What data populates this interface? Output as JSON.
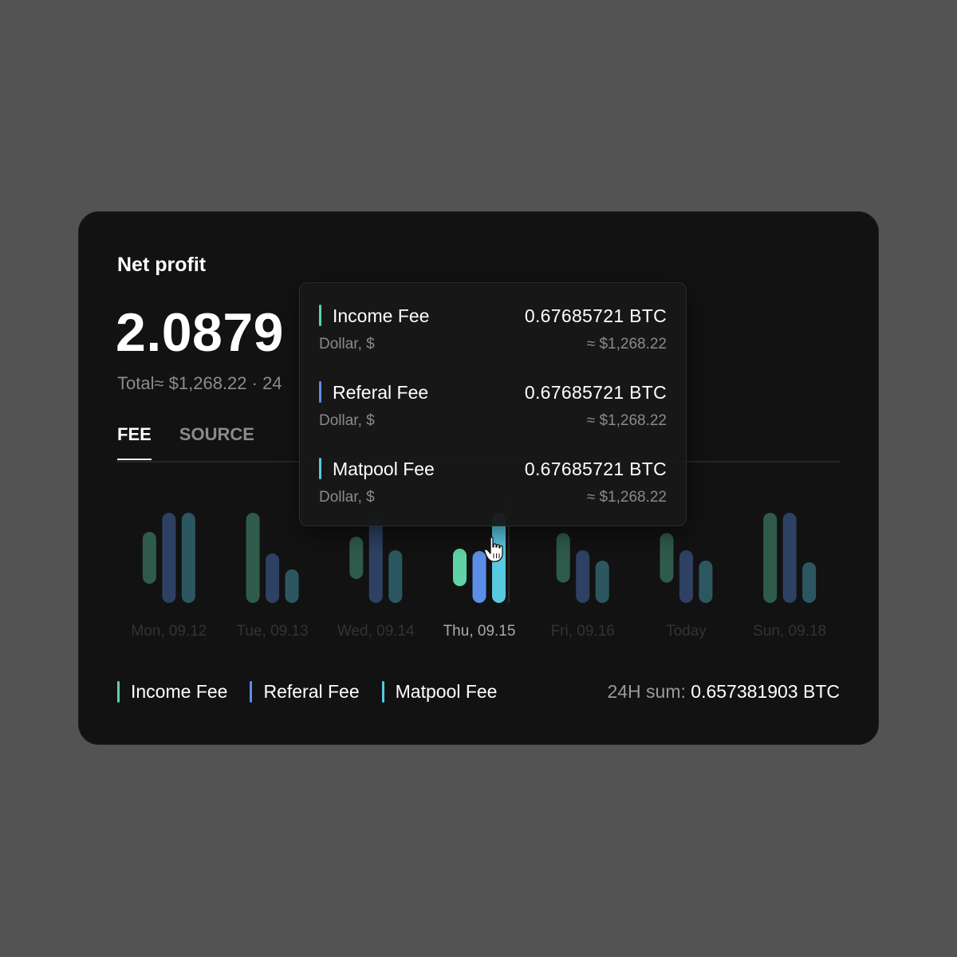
{
  "card": {
    "title": "Net profit",
    "big_value": "2.0879",
    "subtotal": "Total≈ $1,268.22 · 24"
  },
  "tabs": [
    {
      "label": "FEE",
      "active": true
    },
    {
      "label": "SOURCE",
      "active": false
    }
  ],
  "colors": {
    "income": "#5fd3a5",
    "referal": "#5b8ee6",
    "matpool": "#59c9e0",
    "background": "#535353",
    "card": "#121212"
  },
  "chart_data": {
    "type": "bar",
    "categories": [
      "Mon, 09.12",
      "Tue, 09.13",
      "Wed, 09.14",
      "Thu, 09.15",
      "Fri, 09.16",
      "Today",
      "Sun, 09.18"
    ],
    "highlighted_index": 3,
    "series": [
      {
        "name": "Income Fee",
        "color": "#5fd3a5",
        "values": [
          65,
          113,
          53,
          47,
          62,
          62,
          113
        ]
      },
      {
        "name": "Referal Fee",
        "color": "#5b8ee6",
        "values": [
          113,
          62,
          113,
          65,
          66,
          66,
          113
        ]
      },
      {
        "name": "Matpool Fee",
        "color": "#59c9e0",
        "values": [
          113,
          42,
          66,
          113,
          53,
          53,
          51
        ]
      }
    ]
  },
  "legend": [
    {
      "label": "Income Fee",
      "color": "#5fd3a5"
    },
    {
      "label": "Referal Fee",
      "color": "#5b8ee6"
    },
    {
      "label": "Matpool Fee",
      "color": "#59c9e0"
    }
  ],
  "sum": {
    "label": "24H sum: ",
    "value": "0.657381903 BTC"
  },
  "tooltip": {
    "rows": [
      {
        "label": "Income Fee",
        "value": "0.67685721 BTC",
        "sub": "Dollar, $",
        "approx": "≈ $1,268.22",
        "color": "#5fd3a5"
      },
      {
        "label": "Referal Fee",
        "value": "0.67685721 BTC",
        "sub": "Dollar, $",
        "approx": "≈ $1,268.22",
        "color": "#5b8ee6"
      },
      {
        "label": "Matpool Fee",
        "value": "0.67685721 BTC",
        "sub": "Dollar, $",
        "approx": "≈ $1,268.22",
        "color": "#59c9e0"
      }
    ]
  }
}
